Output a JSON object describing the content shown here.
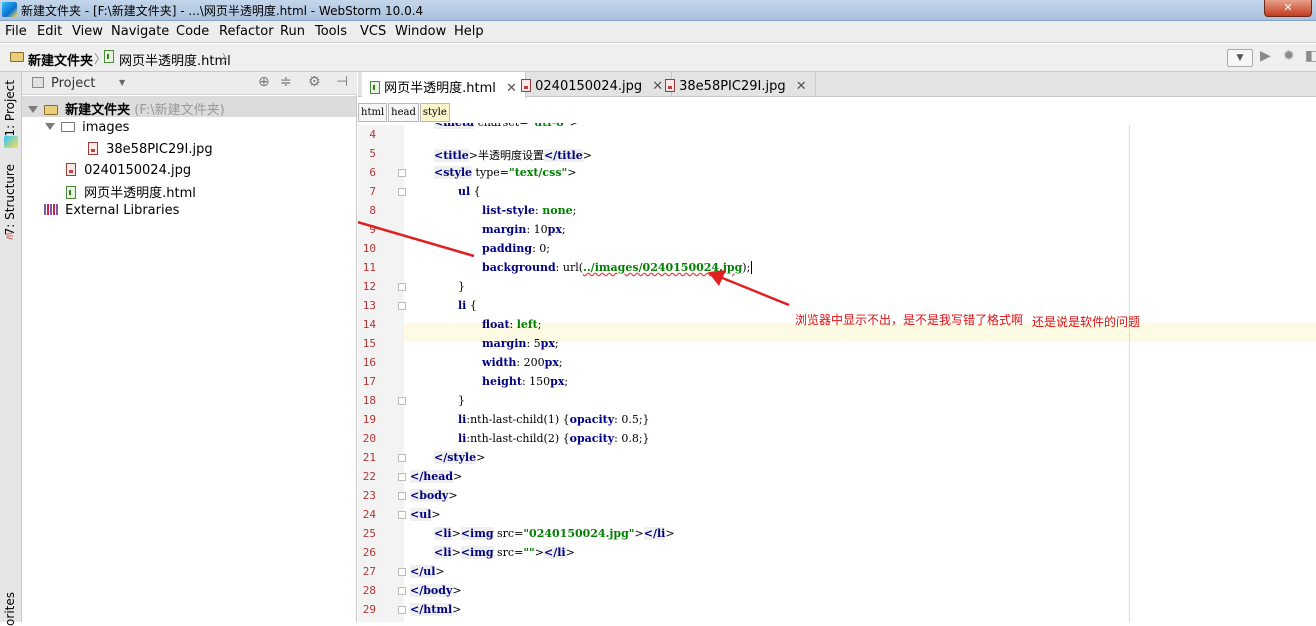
{
  "window": {
    "title": "新建文件夹 - [F:\\新建文件夹] - ...\\网页半透明度.html - WebStorm 10.0.4",
    "close_label": "✕"
  },
  "menu": [
    "File",
    "Edit",
    "View",
    "Navigate",
    "Code",
    "Refactor",
    "Run",
    "Tools",
    "VCS",
    "Window",
    "Help"
  ],
  "nav": {
    "folder": "新建文件夹",
    "file": "网页半透明度.html"
  },
  "left_strip": {
    "project_tab": "1: Project",
    "structure_tab": "7: Structure",
    "favorites_tab": "orites"
  },
  "project": {
    "header": "Project",
    "root": {
      "name": "新建文件夹",
      "path": "(F:\\新建文件夹)"
    },
    "images_folder": "images",
    "image_file": "38e58PIC29I.jpg",
    "jpg_file": "0240150024.jpg",
    "html_file": "网页半透明度.html",
    "libraries": "External Libraries"
  },
  "tabs": [
    {
      "label": "网页半透明度.html",
      "active": true
    },
    {
      "label": "0240150024.jpg",
      "active": false
    },
    {
      "label": "38e58PIC29I.jpg",
      "active": false
    }
  ],
  "breadcrumbs": [
    "html",
    "head",
    "style"
  ],
  "code_lines": [
    {
      "n": "4",
      "text": "<meta charset=\"utf-8\">"
    },
    {
      "n": "5",
      "text": "<title>半透明度设置</title>"
    },
    {
      "n": "6",
      "text": "<style type=\"text/css\">"
    },
    {
      "n": "7",
      "text": "ul {"
    },
    {
      "n": "8",
      "text": "list-style: none;"
    },
    {
      "n": "9",
      "text": "margin: 10px;"
    },
    {
      "n": "10",
      "text": "padding: 0;"
    },
    {
      "n": "11",
      "text": "background: url(../images/0240150024.jpg);"
    },
    {
      "n": "12",
      "text": "}"
    },
    {
      "n": "13",
      "text": "li {"
    },
    {
      "n": "14",
      "text": "float: left;"
    },
    {
      "n": "15",
      "text": "margin: 5px;"
    },
    {
      "n": "16",
      "text": "width: 200px;"
    },
    {
      "n": "17",
      "text": "height: 150px;"
    },
    {
      "n": "18",
      "text": "}"
    },
    {
      "n": "19",
      "text": "li:nth-last-child(1) {opacity: 0.5;}"
    },
    {
      "n": "20",
      "text": "li:nth-last-child(2) {opacity: 0.8;}"
    },
    {
      "n": "21",
      "text": "</style>"
    },
    {
      "n": "22",
      "text": "</head>"
    },
    {
      "n": "23",
      "text": "<body>"
    },
    {
      "n": "24",
      "text": "<ul>"
    },
    {
      "n": "25",
      "text": "<li><img src=\"0240150024.jpg\"></li>"
    },
    {
      "n": "26",
      "text": "<li><img src=\"\"></li>"
    },
    {
      "n": "27",
      "text": "</ul>"
    },
    {
      "n": "28",
      "text": "</body>"
    },
    {
      "n": "29",
      "text": "</html>"
    }
  ],
  "annotations": {
    "note1": "浏览器中显示不出，是不是我写错了格式啊",
    "note2": "还是说是软件的问题"
  },
  "colors": {
    "arrow": "#e02020",
    "note": "#dd1111",
    "tag": "#000080",
    "string": "#008000"
  }
}
